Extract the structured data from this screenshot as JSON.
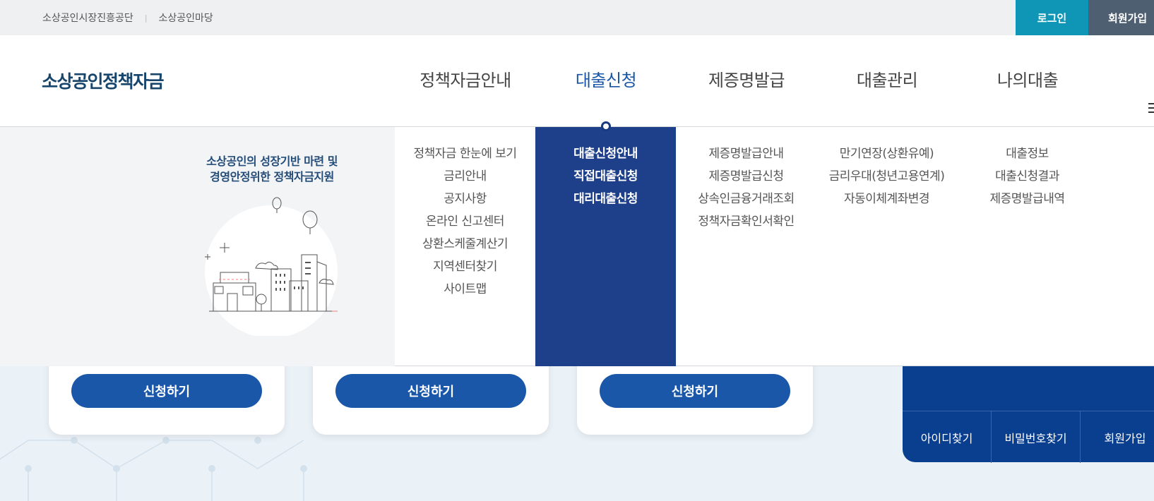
{
  "topbar": {
    "links": [
      "소상공인시장진흥공단",
      "소상공인마당"
    ],
    "login_label": "로그인",
    "join_label": "회원가입"
  },
  "header": {
    "logo": "소상공인정책자금",
    "gnb": [
      "정책자금안내",
      "대출신청",
      "제증명발급",
      "대출관리",
      "나의대출"
    ],
    "active_index": 1
  },
  "promo": {
    "line1": "소상공인의 성장기반 마련 및",
    "line2": "경영안정위한 정책자금지원"
  },
  "submenu": {
    "col1": [
      "정책자금 한눈에 보기",
      "금리안내",
      "공지사항",
      "온라인 신고센터",
      "상환스케줄계산기",
      "지역센터찾기",
      "사이트맵"
    ],
    "col2": [
      "대출신청안내",
      "직접대출신청",
      "대리대출신청"
    ],
    "col3": [
      "제증명발급안내",
      "제증명발급신청",
      "상속인금융거래조회",
      "정책자금확인서확인"
    ],
    "col4": [
      "만기연장(상환유예)",
      "금리우대(청년고용연계)",
      "자동이체계좌변경"
    ],
    "col5": [
      "대출정보",
      "대출신청결과",
      "제증명발급내역"
    ]
  },
  "cards": {
    "apply_label": "신청하기"
  },
  "login_box": {
    "links": [
      "아이디찾기",
      "비밀번호찾기",
      "회원가입"
    ]
  },
  "colors": {
    "accent": "#1a56a6",
    "active_panel": "#1e3f8a",
    "login_button": "#0f96b6",
    "join_button": "#4f5f72"
  }
}
